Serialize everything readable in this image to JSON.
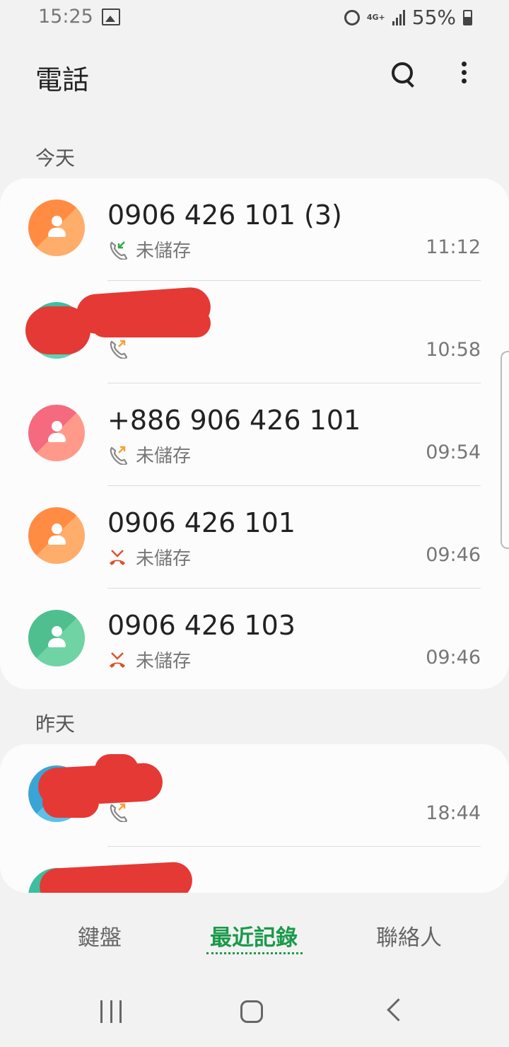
{
  "status_bar": {
    "time": "15:25",
    "network": "4G+",
    "battery": "55%"
  },
  "app": {
    "title": "電話"
  },
  "sections": [
    {
      "label": "今天",
      "calls": [
        {
          "name": "0906 426 101 (3)",
          "sub": "未儲存",
          "time": "11:12",
          "call_type": "incoming",
          "avatar_color": "#ff8c42",
          "avatar_color2": "#ffad6b"
        },
        {
          "name": "",
          "sub": "",
          "time": "10:58",
          "call_type": "outgoing",
          "avatar_color": "#3cbf9f",
          "avatar_color2": "#5fd3b3",
          "redacted": true
        },
        {
          "name": "+886 906 426 101",
          "sub": "未儲存",
          "time": "09:54",
          "call_type": "outgoing",
          "avatar_color": "#f56a7f",
          "avatar_color2": "#ff9a8a"
        },
        {
          "name": "0906 426 101",
          "sub": "未儲存",
          "time": "09:46",
          "call_type": "missed",
          "avatar_color": "#ff8c42",
          "avatar_color2": "#ffad6b"
        },
        {
          "name": "0906 426 103",
          "sub": "未儲存",
          "time": "09:46",
          "call_type": "missed",
          "avatar_color": "#4fbf8f",
          "avatar_color2": "#6fd3a3"
        }
      ]
    },
    {
      "label": "昨天",
      "calls": [
        {
          "name": "",
          "sub": "",
          "time": "18:44",
          "call_type": "outgoing",
          "avatar_color": "#3aa4d6",
          "avatar_color2": "#5cc0e8",
          "redacted": true
        },
        {
          "name": "",
          "sub": "",
          "time": "",
          "call_type": "",
          "avatar_color": "#3cbf9f",
          "avatar_color2": "#5fd3b3",
          "redacted": true
        }
      ]
    }
  ],
  "tabs": [
    {
      "label": "鍵盤",
      "active": false
    },
    {
      "label": "最近記錄",
      "active": true
    },
    {
      "label": "聯絡人",
      "active": false
    }
  ],
  "colors": {
    "accent": "#1a9a4a",
    "missed": "#e0502a",
    "incoming": "#2ea84a",
    "outgoing": "#f2a33a",
    "redaction": "#e53935"
  }
}
